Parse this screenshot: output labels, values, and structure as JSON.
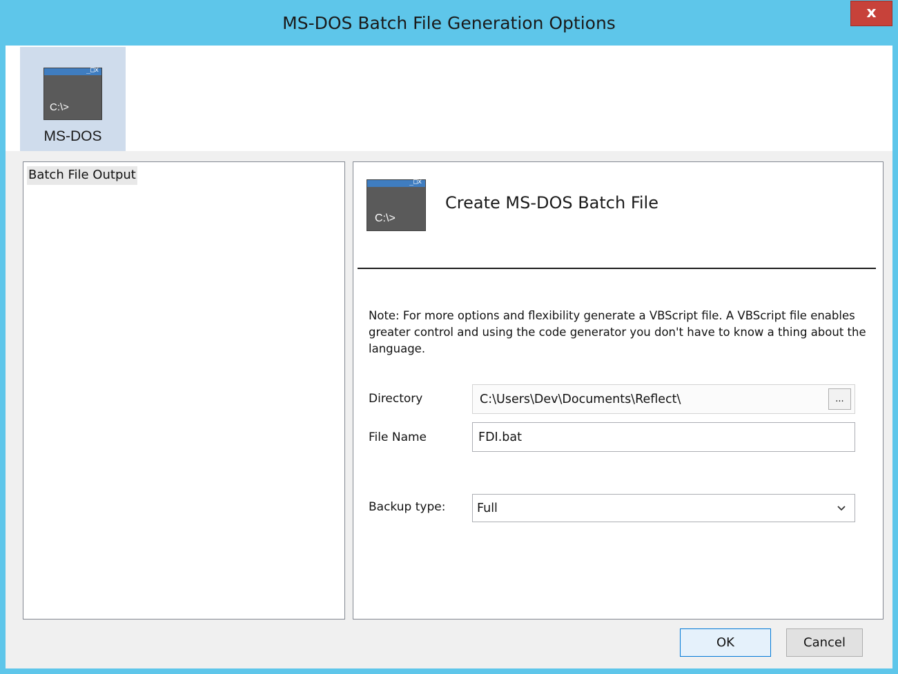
{
  "window": {
    "title": "MS-DOS Batch File Generation Options",
    "close_glyph": "x"
  },
  "ribbon": {
    "item_label": "MS-DOS",
    "icon": "ms-dos-console-icon",
    "icon_prompt": "C:\\>",
    "icon_window_buttons": "_□x"
  },
  "left_panel": {
    "items": [
      {
        "label": "Batch File Output",
        "selected": true
      }
    ]
  },
  "right_panel": {
    "header_title": "Create MS-DOS Batch File",
    "header_icon_prompt": "C:\\>",
    "header_icon_window_buttons": "_□x",
    "note": "Note: For more options and flexibility generate a VBScript file. A VBScript file enables greater control and using the code generator you don't have to know a thing about the language.",
    "directory_label": "Directory",
    "directory_value": "C:\\Users\\Dev\\Documents\\Reflect\\",
    "browse_label": "...",
    "file_name_label": "File Name",
    "file_name_value": "FDI.bat",
    "backup_type_label": "Backup type:",
    "backup_type_value": "Full"
  },
  "buttons": {
    "ok": "OK",
    "cancel": "Cancel"
  },
  "colors": {
    "titlebar": "#5ec6ea",
    "close": "#c7423a",
    "ribbon_selected": "#cfdcec",
    "console_bar": "#3f7dc0",
    "console_body": "#5a5a5a"
  }
}
